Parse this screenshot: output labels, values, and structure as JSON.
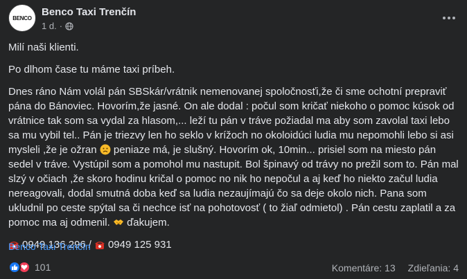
{
  "post": {
    "page_name": "Benco Taxi Trenčín",
    "avatar_text": "BENCO",
    "time": "1 d.",
    "time_separator": "·",
    "privacy_icon": "globe-icon",
    "more_icon": "ellipsis-icon",
    "greeting": "Milí naši klienti.",
    "intro": "Po dlhom čase tu máme taxi príbeh.",
    "story_part1": " Dnes ráno Nám volál pán SBSkár/vrátnik nemenovanej spoločnosťi,že či sme ochotní prepraviť pána do Bánoviec. Hovorím,že jasné. On ale dodal : počul som kričať niekoho o pomoc kúsok od vrátnice tak som sa vydal za hlasom,... leží tu pán v tráve požiadal ma aby som zavolal taxi lebo sa mu vybil tel.. Pán je triezvy len ho seklo v krížoch no okoloidúci ludia mu nepomohli lebo si asi mysleli ,že je ožran",
    "story_emoji1": "worried-face-emoji",
    "story_part2": " peniaze má, je slušný. Hovorím ok, 10min... prisiel som na miesto pán sedel v tráve. Vystúpil som a pomohol mu nastupit. Bol špinavý od trávy no prežil som to. Pán mal slzý v očiach ,že skoro hodinu kričal o pomoc no nik ho nepočul a aj keď ho niekto začul ludia nereagovali, dodal smutná doba keď sa ludia nezaujímajú čo sa deje okolo nich. Pana som ukludnil po ceste spýtal sa či nechce isť na pohotovosť ( to žiaľ odmietol) . Pán cestu zaplatil a za pomoc ma aj odmenil.",
    "story_emoji2": "handshake-emoji",
    "story_part3": " ďakujem.",
    "phone1": "0949 136 296",
    "phone_separator": "/",
    "phone2": "0949 125 931",
    "phone_icon": "telephone-icon",
    "signature_link": "Benco Taxi Trenčín"
  },
  "footer": {
    "reaction_icons": [
      "like-icon",
      "love-icon"
    ],
    "reaction_count": "101",
    "comments": "Komentáre: 13",
    "shares": "Zdieľania: 4"
  },
  "colors": {
    "background": "#242526",
    "text": "#e4e6eb",
    "secondary_text": "#b0b3b8",
    "link": "#4599ff",
    "like_blue": "#1877f2",
    "love_red": "#f33e58"
  }
}
